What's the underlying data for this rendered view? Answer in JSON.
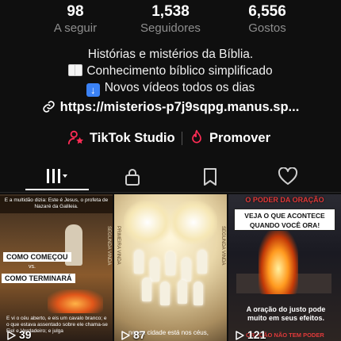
{
  "profile": {
    "stats": [
      {
        "value": "98",
        "label": "A seguir"
      },
      {
        "value": "1,538",
        "label": "Seguidores"
      },
      {
        "value": "6,556",
        "label": "Gostos"
      }
    ],
    "bio": [
      "Histórias e mistérios da Bíblia.",
      "Conhecimento bíblico simplificado",
      "Novos vídeos todos os dias"
    ],
    "bio_icons": [
      "open-book-emoji",
      "down-arrow-emoji"
    ],
    "link": "https://misterios-p7j9sqpg.manus.sp...",
    "actions": {
      "studio_label": "TikTok Studio",
      "promote_label": "Promover"
    },
    "accent_color": "#fe2c55"
  },
  "tabs": [
    {
      "name": "videos",
      "icon": "grid-icon",
      "active": true
    },
    {
      "name": "private",
      "icon": "lock-icon",
      "active": false
    },
    {
      "name": "reposts",
      "icon": "bookmark-icon",
      "active": false
    },
    {
      "name": "liked",
      "icon": "heart-icon",
      "active": false
    }
  ],
  "videos": [
    {
      "views": "39",
      "top_text": "E a multidão dizia: Este é Jesus, o profeta de Nazaré da Galileia.",
      "box1": "COMO COMEÇOU",
      "vs": "vs.",
      "box2": "COMO TERMINARÁ",
      "side_text": "SEGUNDA VINDA",
      "bottom_text": "E vi o céu aberto, e eis um cavalo branco; e o que estava assentado sobre ele chama-se Fiel e Verdadeiro; e julga"
    },
    {
      "views": "87",
      "side_text_left": "PRIMEIRA VINDA",
      "side_text_right": "SEGUNDA VINDA",
      "caption": "nossa cidade está nos céus,"
    },
    {
      "views": "121",
      "title": "O PODER DA ORAÇÃO",
      "banner": "VEJA O QUE ACONTECE QUANDO VOCÊ ORA!",
      "quote": "A oração do justo pode muito em seus efeitos.",
      "red_tag": "ORAÇÃO NÃO TEM PODER"
    }
  ]
}
